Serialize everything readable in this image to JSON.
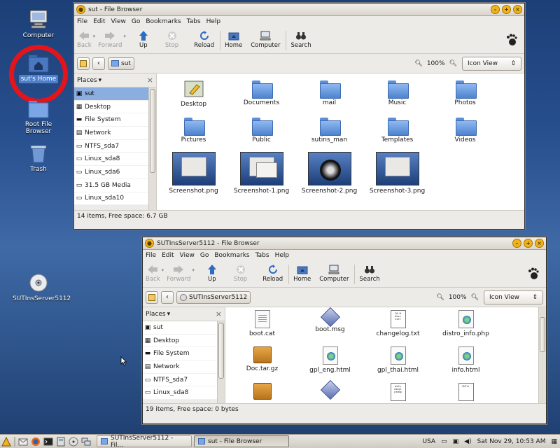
{
  "desktop": {
    "icons": [
      {
        "label": "Computer"
      },
      {
        "label": "sut's Home"
      },
      {
        "label": "Root File Browser"
      },
      {
        "label": "Trash"
      },
      {
        "label": "SUTInsServer5112"
      }
    ]
  },
  "win1": {
    "title": "sut - File Browser",
    "menu": [
      "File",
      "Edit",
      "View",
      "Go",
      "Bookmarks",
      "Tabs",
      "Help"
    ],
    "toolbar": {
      "back": "Back",
      "forward": "Forward",
      "up": "Up",
      "stop": "Stop",
      "reload": "Reload",
      "home": "Home",
      "computer": "Computer",
      "search": "Search"
    },
    "location": "sut",
    "zoom": "100%",
    "view_mode": "Icon View",
    "places_label": "Places",
    "places": [
      "sut",
      "Desktop",
      "File System",
      "Network",
      "NTFS_sda7",
      "Linux_sda8",
      "Linux_sda6",
      "31.5 GB Media",
      "Linux_sda10"
    ],
    "files": [
      "Desktop",
      "Documents",
      "mail",
      "Music",
      "Photos",
      "Pictures",
      "Public",
      "sutins_man",
      "Templates",
      "Videos",
      "Screenshot.png",
      "Screenshot-1.png",
      "Screenshot-2.png",
      "Screenshot-3.png"
    ],
    "status": "14 items, Free space: 6.7 GB"
  },
  "win2": {
    "title": "SUTInsServer5112 - File Browser",
    "menu": [
      "File",
      "Edit",
      "View",
      "Go",
      "Bookmarks",
      "Tabs",
      "Help"
    ],
    "toolbar": {
      "back": "Back",
      "forward": "Forward",
      "up": "Up",
      "stop": "Stop",
      "reload": "Reload",
      "home": "Home",
      "computer": "Computer",
      "search": "Search"
    },
    "location": "SUTInsServer5112",
    "zoom": "100%",
    "view_mode": "Icon View",
    "places_label": "Places",
    "places": [
      "sut",
      "Desktop",
      "File System",
      "Network",
      "NTFS_sda7",
      "Linux_sda8"
    ],
    "files": [
      "boot.cat",
      "boot.msg",
      "changelog.txt",
      "distro_info.php",
      "Doc.tar.gz",
      "gpl_eng.html",
      "gpl_thai.html",
      "info.html"
    ],
    "status": "19 items, Free space: 0 bytes"
  },
  "taskbar": {
    "tasks": [
      "SUTInsServer5112 - Fil...",
      "sut - File Browser"
    ],
    "lang": "USA",
    "clock": "Sat Nov 29, 10:53 AM"
  }
}
